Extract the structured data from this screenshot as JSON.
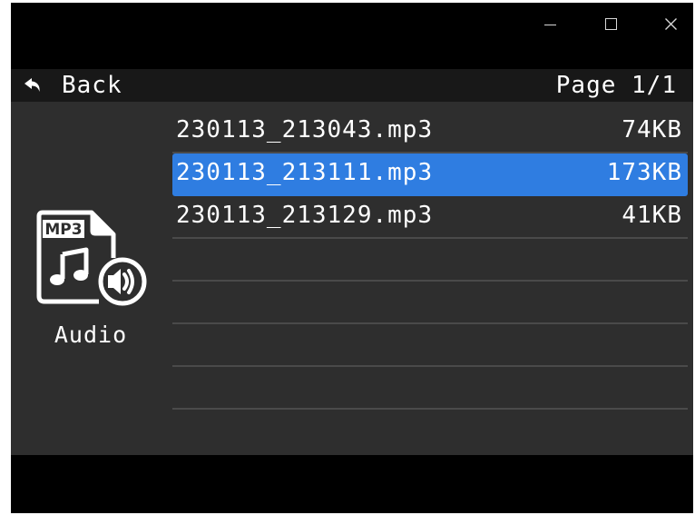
{
  "window": {
    "controls": {
      "minimize_icon": "minimize-icon",
      "maximize_icon": "maximize-icon",
      "close_icon": "close-icon"
    }
  },
  "nav": {
    "back_icon": "back-arrow-icon",
    "back_label": "Back",
    "page_indicator": "Page 1/1"
  },
  "category": {
    "icon": "mp3-audio-file-icon",
    "icon_badge_text": "MP3",
    "label": "Audio"
  },
  "files": [
    {
      "name": "230113_213043.mp3",
      "size": "74KB",
      "selected": false
    },
    {
      "name": "230113_213111.mp3",
      "size": "173KB",
      "selected": true
    },
    {
      "name": "230113_213129.mp3",
      "size": "41KB",
      "selected": false
    }
  ],
  "colors": {
    "selection": "#2f7de1",
    "list_background": "#2e2e2e",
    "navbar_background": "#181818",
    "frame_background": "#000000",
    "divider": "#4a4a4a",
    "text": "#ffffff"
  }
}
